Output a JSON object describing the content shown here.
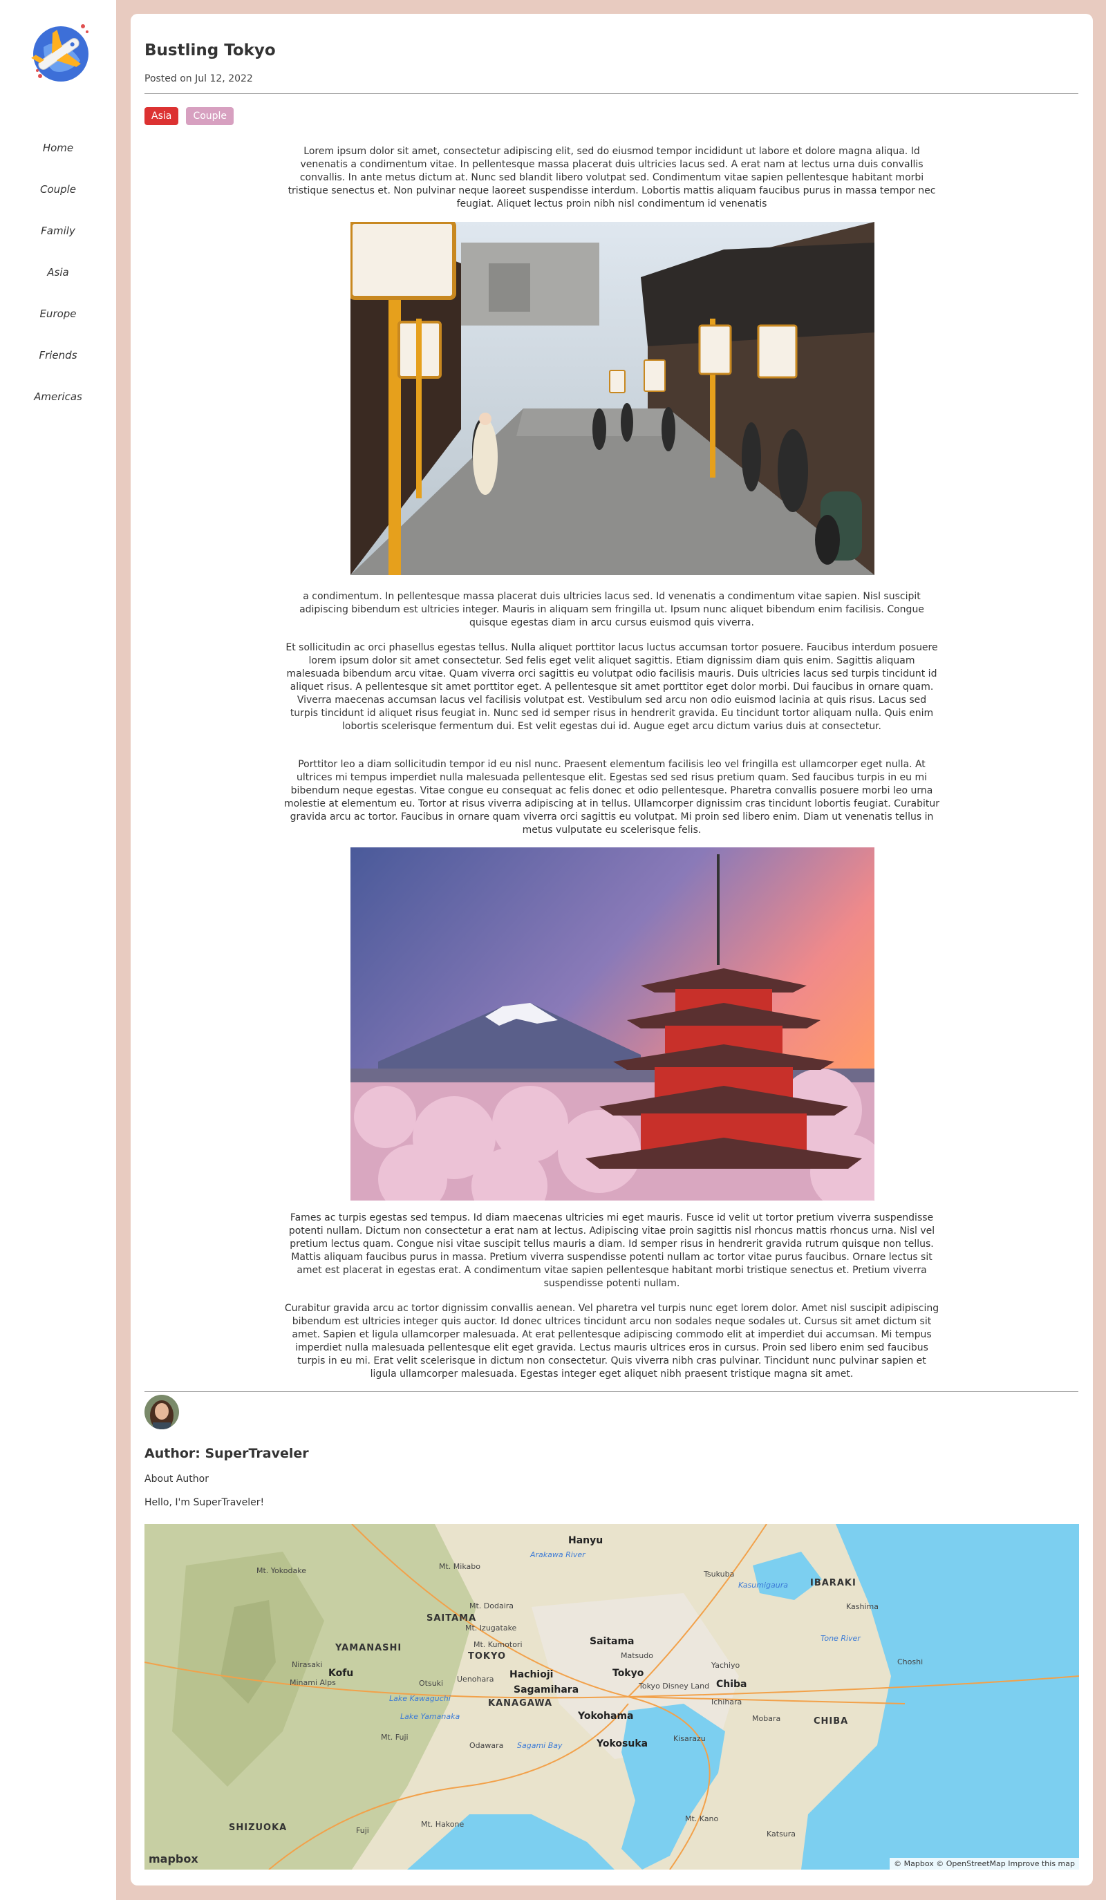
{
  "nav": {
    "items": [
      "Home",
      "Couple",
      "Family",
      "Asia",
      "Europe",
      "Friends",
      "Americas"
    ]
  },
  "post": {
    "title": "Bustling Tokyo",
    "date": "Posted on Jul 12, 2022",
    "tags": [
      {
        "label": "Asia",
        "color": "#dc3232"
      },
      {
        "label": "Couple",
        "color": "#d7a0c0"
      }
    ],
    "paragraphs": [
      "Lorem ipsum dolor sit amet, consectetur adipiscing elit, sed do eiusmod tempor incididunt ut labore et dolore magna aliqua. Id venenatis a condimentum vitae. In pellentesque massa placerat duis ultricies lacus sed. A erat nam at lectus urna duis convallis convallis. In ante metus dictum at. Nunc sed blandit libero volutpat sed. Condimentum vitae sapien pellentesque habitant morbi tristique senectus et. Non pulvinar neque laoreet suspendisse interdum. Lobortis mattis aliquam faucibus purus in massa tempor nec feugiat. Aliquet lectus proin nibh nisl condimentum id venenatis",
      "a condimentum. In pellentesque massa placerat duis ultricies lacus sed. Id venenatis a condimentum vitae sapien. Nisl suscipit adipiscing bibendum est ultricies integer. Mauris in aliquam sem fringilla ut. Ipsum nunc aliquet bibendum enim facilisis. Congue quisque egestas diam in arcu cursus euismod quis viverra.",
      "Et sollicitudin ac orci phasellus egestas tellus. Nulla aliquet porttitor lacus luctus accumsan tortor posuere. Faucibus interdum posuere lorem ipsum dolor sit amet consectetur. Sed felis eget velit aliquet sagittis. Etiam dignissim diam quis enim. Sagittis aliquam malesuada bibendum arcu vitae. Quam viverra orci sagittis eu volutpat odio facilisis mauris. Duis ultricies lacus sed turpis tincidunt id aliquet risus. A pellentesque sit amet porttitor eget. A pellentesque sit amet porttitor eget dolor morbi. Dui faucibus in ornare quam. Viverra maecenas accumsan lacus vel facilisis volutpat est. Vestibulum sed arcu non odio euismod lacinia at quis risus. Lacus sed turpis tincidunt id aliquet risus feugiat in. Nunc sed id semper risus in hendrerit gravida. Eu tincidunt tortor aliquam nulla. Quis enim lobortis scelerisque fermentum dui. Est velit egestas dui id. Augue eget arcu dictum varius duis at consectetur.",
      "Porttitor leo a diam sollicitudin tempor id eu nisl nunc. Praesent elementum facilisis leo vel fringilla est ullamcorper eget nulla. At ultrices mi tempus imperdiet nulla malesuada pellentesque elit. Egestas sed sed risus pretium quam. Sed faucibus turpis in eu mi bibendum neque egestas. Vitae congue eu consequat ac felis donec et odio pellentesque. Pharetra convallis posuere morbi leo urna molestie at elementum eu. Tortor at risus viverra adipiscing at in tellus. Ullamcorper dignissim cras tincidunt lobortis feugiat. Curabitur gravida arcu ac tortor. Faucibus in ornare quam viverra orci sagittis eu volutpat. Mi proin sed libero enim. Diam ut venenatis tellus in metus vulputate eu scelerisque felis.",
      "Fames ac turpis egestas sed tempus. Id diam maecenas ultricies mi eget mauris. Fusce id velit ut tortor pretium viverra suspendisse potenti nullam. Dictum non consectetur a erat nam at lectus. Adipiscing vitae proin sagittis nisl rhoncus mattis rhoncus urna. Nisl vel pretium lectus quam. Congue nisi vitae suscipit tellus mauris a diam. Id semper risus in hendrerit gravida rutrum quisque non tellus. Mattis aliquam faucibus purus in massa. Pretium viverra suspendisse potenti nullam ac tortor vitae purus faucibus. Ornare lectus sit amet est placerat in egestas erat. A condimentum vitae sapien pellentesque habitant morbi tristique senectus et. Pretium viverra suspendisse potenti nullam.",
      "Curabitur gravida arcu ac tortor dignissim convallis aenean. Vel pharetra vel turpis nunc eget lorem dolor. Amet nisl suscipit adipiscing bibendum est ultricies integer quis auctor. Id donec ultrices tincidunt arcu non sodales neque sodales ut. Cursus sit amet dictum sit amet. Sapien et ligula ullamcorper malesuada. At erat pellentesque adipiscing commodo elit at imperdiet dui accumsan. Mi tempus imperdiet nulla malesuada pellentesque elit eget gravida. Lectus mauris ultrices eros in cursus. Proin sed libero enim sed faucibus turpis in eu mi. Erat velit scelerisque in dictum non consectetur. Quis viverra nibh cras pulvinar. Tincidunt nunc pulvinar sapien et ligula ullamcorper malesuada. Egestas integer eget aliquet nibh praesent tristique magna sit amet."
    ]
  },
  "author": {
    "name": "Author: SuperTraveler",
    "about_label": "About Author",
    "greeting": "Hello, I'm SuperTraveler!"
  },
  "map": {
    "labels": [
      {
        "text": "Hanyu",
        "kind": "city"
      },
      {
        "text": "Tsukuba",
        "kind": "small"
      },
      {
        "text": "IBARAKI",
        "kind": "pref"
      },
      {
        "text": "Kasumigaura",
        "kind": "water"
      },
      {
        "text": "Kashima",
        "kind": "small"
      },
      {
        "text": "SAITAMA",
        "kind": "pref"
      },
      {
        "text": "Saitama",
        "kind": "city"
      },
      {
        "text": "Matsudo",
        "kind": "small"
      },
      {
        "text": "YAMANASHI",
        "kind": "pref"
      },
      {
        "text": "TOKYO",
        "kind": "pref"
      },
      {
        "text": "Tokyo",
        "kind": "city"
      },
      {
        "text": "Yachiyo",
        "kind": "small"
      },
      {
        "text": "Chiba",
        "kind": "city"
      },
      {
        "text": "Choshi",
        "kind": "small"
      },
      {
        "text": "Kofu",
        "kind": "city"
      },
      {
        "text": "Hachioji",
        "kind": "city"
      },
      {
        "text": "Sagamihara",
        "kind": "city"
      },
      {
        "text": "KANAGAWA",
        "kind": "pref"
      },
      {
        "text": "Yokohama",
        "kind": "city"
      },
      {
        "text": "Ichihara",
        "kind": "small"
      },
      {
        "text": "Mobara",
        "kind": "small"
      },
      {
        "text": "CHIBA",
        "kind": "pref"
      },
      {
        "text": "Kisarazu",
        "kind": "small"
      },
      {
        "text": "Yokosuka",
        "kind": "city"
      },
      {
        "text": "Odawara",
        "kind": "small"
      },
      {
        "text": "Sagami Bay",
        "kind": "water"
      },
      {
        "text": "SHIZUOKA",
        "kind": "pref"
      },
      {
        "text": "Fuji",
        "kind": "small"
      },
      {
        "text": "Mt. Kano",
        "kind": "small"
      },
      {
        "text": "Katsura",
        "kind": "small"
      },
      {
        "text": "Mt. Yokodake",
        "kind": "small"
      },
      {
        "text": "Mt. Mikabo",
        "kind": "small"
      },
      {
        "text": "Mt. Dodaira",
        "kind": "small"
      },
      {
        "text": "Mt. Izugatake",
        "kind": "small"
      },
      {
        "text": "Mt. Kumotori",
        "kind": "small"
      },
      {
        "text": "Nirasaki",
        "kind": "small"
      },
      {
        "text": "Minami Alps",
        "kind": "small"
      },
      {
        "text": "Otsuki",
        "kind": "small"
      },
      {
        "text": "Uenohara",
        "kind": "small"
      },
      {
        "text": "Lake Kawaguchi",
        "kind": "water"
      },
      {
        "text": "Lake Yamanaka",
        "kind": "water"
      },
      {
        "text": "Tokyo Disney Land",
        "kind": "small"
      },
      {
        "text": "Tone River",
        "kind": "water"
      },
      {
        "text": "Arakawa River",
        "kind": "water"
      },
      {
        "text": "Mt. Fuji",
        "kind": "small"
      },
      {
        "text": "Mt. Hakone",
        "kind": "small"
      }
    ],
    "attribution": "© Mapbox © OpenStreetMap  Improve this map",
    "logo": "mapbox",
    "colors": {
      "land": "#e9e3cc",
      "sea": "#7ccff0",
      "mountain": "#c7cfa3",
      "urban": "#ece7dd"
    }
  }
}
